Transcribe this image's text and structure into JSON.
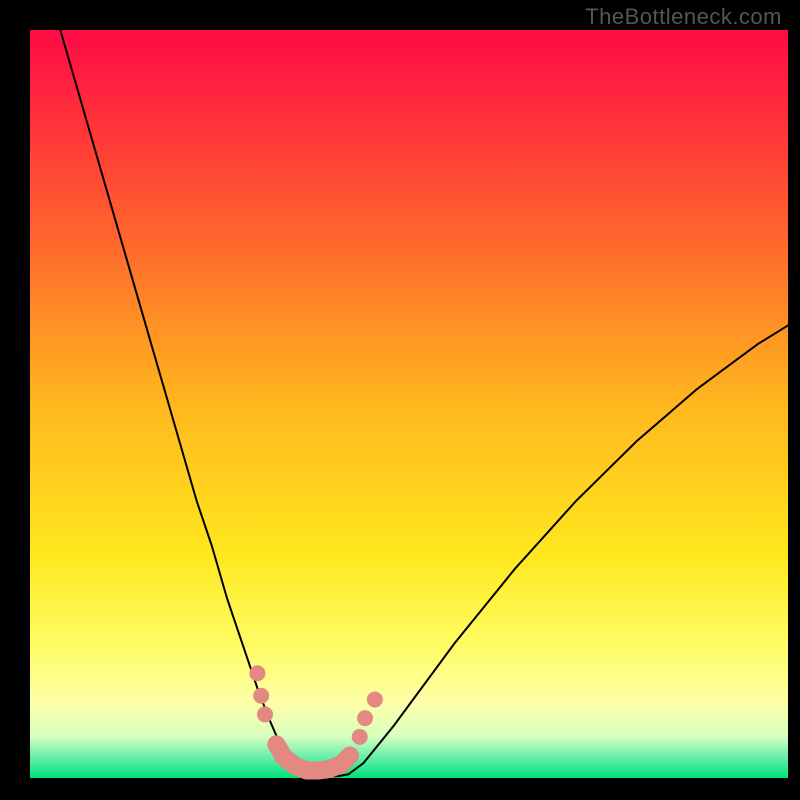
{
  "watermark": "TheBottleneck.com",
  "chart_data": {
    "type": "line",
    "title": "",
    "xlabel": "",
    "ylabel": "",
    "xlim": [
      0,
      100
    ],
    "ylim": [
      0,
      100
    ],
    "grid": false,
    "background_gradient": {
      "stops": [
        {
          "pos": 0.0,
          "color": "#ff0a45"
        },
        {
          "pos": 0.25,
          "color": "#ff5c2f"
        },
        {
          "pos": 0.5,
          "color": "#ffb71e"
        },
        {
          "pos": 0.7,
          "color": "#ffe71e"
        },
        {
          "pos": 0.82,
          "color": "#fffc63"
        },
        {
          "pos": 0.9,
          "color": "#fdffa8"
        },
        {
          "pos": 0.945,
          "color": "#d7ffbe"
        },
        {
          "pos": 0.97,
          "color": "#6fefad"
        },
        {
          "pos": 1.0,
          "color": "#00e37a"
        }
      ]
    },
    "series": [
      {
        "name": "left-curve",
        "color": "#000000",
        "width": 2,
        "x": [
          4.0,
          6.0,
          8.0,
          10.0,
          12.0,
          14.0,
          16.0,
          18.0,
          20.0,
          22.0,
          24.0,
          26.0,
          28.0,
          30.0,
          31.5,
          33.0,
          34.5,
          36.0
        ],
        "values": [
          100,
          93,
          86,
          79,
          72,
          65,
          58,
          51,
          44,
          37,
          31,
          24,
          18,
          12,
          8.0,
          4.5,
          2.0,
          0.4
        ]
      },
      {
        "name": "valley-flat",
        "color": "#000000",
        "width": 2,
        "x": [
          36.0,
          37.0,
          38.0,
          39.0,
          40.0,
          41.0,
          42.0
        ],
        "values": [
          0.4,
          0.2,
          0.2,
          0.2,
          0.2,
          0.3,
          0.5
        ]
      },
      {
        "name": "right-curve",
        "color": "#000000",
        "width": 2,
        "x": [
          42.0,
          44.0,
          48.0,
          52.0,
          56.0,
          60.0,
          64.0,
          68.0,
          72.0,
          76.0,
          80.0,
          84.0,
          88.0,
          92.0,
          96.0,
          100.0
        ],
        "values": [
          0.5,
          2.0,
          7.0,
          12.5,
          18.0,
          23.0,
          28.0,
          32.5,
          37.0,
          41.0,
          45.0,
          48.5,
          52.0,
          55.0,
          58.0,
          60.5
        ]
      }
    ],
    "annotations": {
      "marker_color": "#e38982",
      "marker_radius_px": 8,
      "left_dot_cluster": {
        "x": [
          30.0,
          30.5,
          31.0
        ],
        "y": [
          14.0,
          11.0,
          8.5
        ]
      },
      "right_dot_cluster": {
        "x": [
          43.5,
          44.2,
          45.5
        ],
        "y": [
          5.5,
          8.0,
          10.5
        ]
      },
      "bottom_stroke": {
        "x": [
          32.5,
          33.5,
          35.0,
          36.5,
          38.0,
          39.5,
          41.0,
          42.2
        ],
        "y": [
          4.5,
          2.8,
          1.6,
          1.0,
          1.0,
          1.2,
          1.8,
          3.0
        ]
      }
    }
  }
}
